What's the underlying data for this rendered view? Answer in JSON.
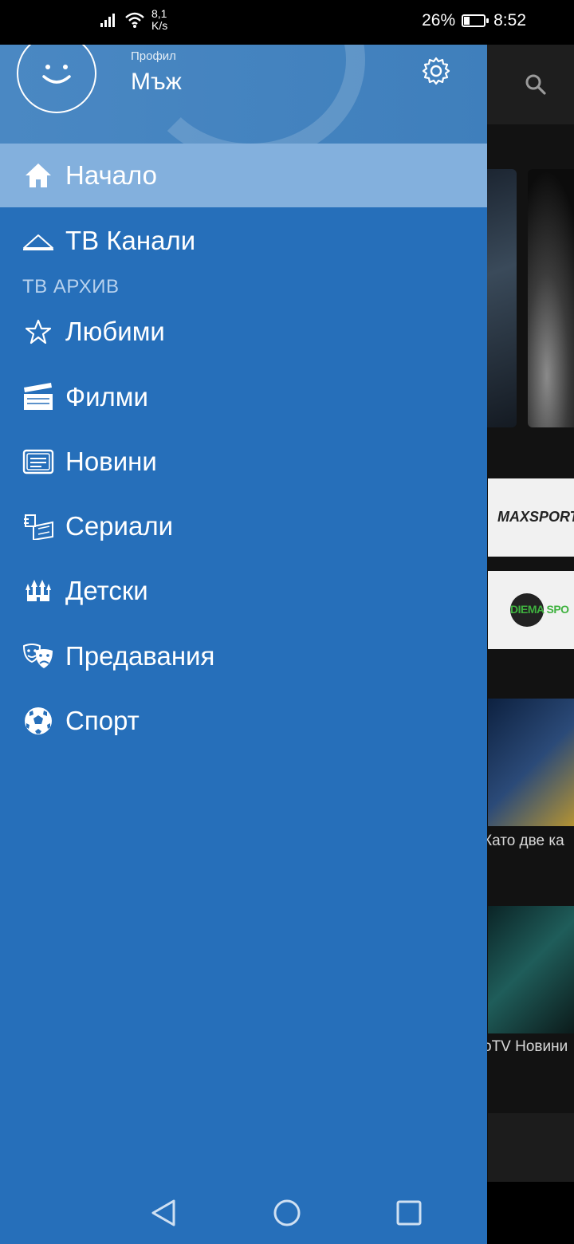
{
  "status_bar": {
    "net_speed_value": "8,1",
    "net_speed_unit": "K/s",
    "battery_percent": "26%",
    "battery_level": 0.26,
    "time": "8:52"
  },
  "drawer": {
    "profile": {
      "caption": "Профил",
      "name": "Мъж",
      "avatar_icon": "smiley-face-icon",
      "settings_icon": "gear-icon"
    },
    "menu": {
      "home": "Начало",
      "tv_channels": "ТВ Канали",
      "section_archive": "ТВ АРХИВ",
      "favorites": "Любими",
      "movies": "Филми",
      "news": "Новини",
      "series": "Сериали",
      "kids": "Детски",
      "shows": "Предавания",
      "sport": "Спорт"
    },
    "active_item": "home",
    "colors": {
      "drawer_bg": "#266fba",
      "active_bg": "#83b0dd",
      "header_bg": "#4a88c3"
    }
  },
  "background": {
    "search_icon": "search-icon",
    "banner1_text": "MAXSPORT",
    "banner2_text": "DIEMA SPO",
    "item1_title": "Като две ка",
    "item2_title": "oTV Новини"
  },
  "navbar": {
    "back_icon": "triangle-back-icon",
    "home_icon": "circle-home-icon",
    "recents_icon": "square-recents-icon"
  }
}
